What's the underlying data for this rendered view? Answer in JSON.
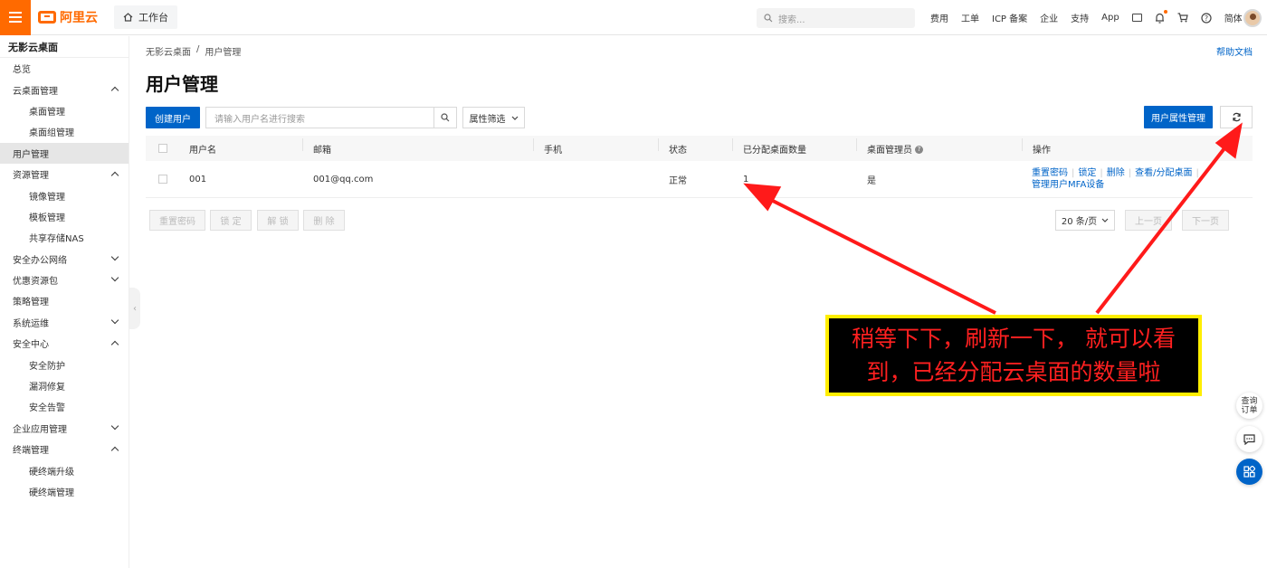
{
  "header": {
    "brand": "阿里云",
    "workbench": "工作台",
    "search_placeholder": "搜索...",
    "nav": [
      "费用",
      "工单",
      "ICP 备案",
      "企业",
      "支持",
      "App"
    ],
    "language": "简体",
    "accent_color": "#ff6a00"
  },
  "sidebar": {
    "title": "无影云桌面",
    "items": [
      {
        "label": "总览",
        "level": 0,
        "chevron": ""
      },
      {
        "label": "云桌面管理",
        "level": 0,
        "chevron": "up"
      },
      {
        "label": "桌面管理",
        "level": 1,
        "chevron": ""
      },
      {
        "label": "桌面组管理",
        "level": 1,
        "chevron": ""
      },
      {
        "label": "用户管理",
        "level": 0,
        "chevron": "",
        "active": true
      },
      {
        "label": "资源管理",
        "level": 0,
        "chevron": "up"
      },
      {
        "label": "镜像管理",
        "level": 1,
        "chevron": ""
      },
      {
        "label": "模板管理",
        "level": 1,
        "chevron": ""
      },
      {
        "label": "共享存储NAS",
        "level": 1,
        "chevron": ""
      },
      {
        "label": "安全办公网络",
        "level": 0,
        "chevron": "down"
      },
      {
        "label": "优惠资源包",
        "level": 0,
        "chevron": "down"
      },
      {
        "label": "策略管理",
        "level": 0,
        "chevron": ""
      },
      {
        "label": "系统运维",
        "level": 0,
        "chevron": "down"
      },
      {
        "label": "安全中心",
        "level": 0,
        "chevron": "up"
      },
      {
        "label": "安全防护",
        "level": 1,
        "chevron": ""
      },
      {
        "label": "漏洞修复",
        "level": 1,
        "chevron": ""
      },
      {
        "label": "安全告警",
        "level": 1,
        "chevron": ""
      },
      {
        "label": "企业应用管理",
        "level": 0,
        "chevron": "down"
      },
      {
        "label": "终端管理",
        "level": 0,
        "chevron": "up"
      },
      {
        "label": "硬终端升级",
        "level": 1,
        "chevron": ""
      },
      {
        "label": "硬终端管理",
        "level": 1,
        "chevron": ""
      }
    ]
  },
  "main": {
    "breadcrumb": [
      "无影云桌面",
      "/",
      "用户管理"
    ],
    "help_link": "帮助文档",
    "title": "用户管理",
    "create_button": "创建用户",
    "search_placeholder": "请输入用户名进行搜索",
    "filter_button": "属性筛选",
    "attr_button": "用户属性管理",
    "primary_color": "#0064c8"
  },
  "table": {
    "columns": [
      "用户名",
      "邮箱",
      "手机",
      "状态",
      "已分配桌面数量",
      "桌面管理员",
      "操作"
    ],
    "rows": [
      {
        "username": "001",
        "email": "001@qq.com",
        "phone": "",
        "status": "正常",
        "desktops": "1",
        "admin": "是",
        "ops": [
          "重置密码",
          "锁定",
          "删除",
          "查看/分配桌面",
          "管理用户MFA设备"
        ]
      }
    ]
  },
  "footer": {
    "bulk_buttons": [
      "重置密码",
      "锁 定",
      "解 锁",
      "删 除"
    ],
    "page_size": "20 条/页",
    "prev": "上一页",
    "next": "下一页"
  },
  "annotation": {
    "text_line1": "稍等下下，刷新一下， 就可以看",
    "text_line2": "到，已经分配云桌面的数量啦"
  },
  "floating": {
    "order_query": "查询订单"
  }
}
